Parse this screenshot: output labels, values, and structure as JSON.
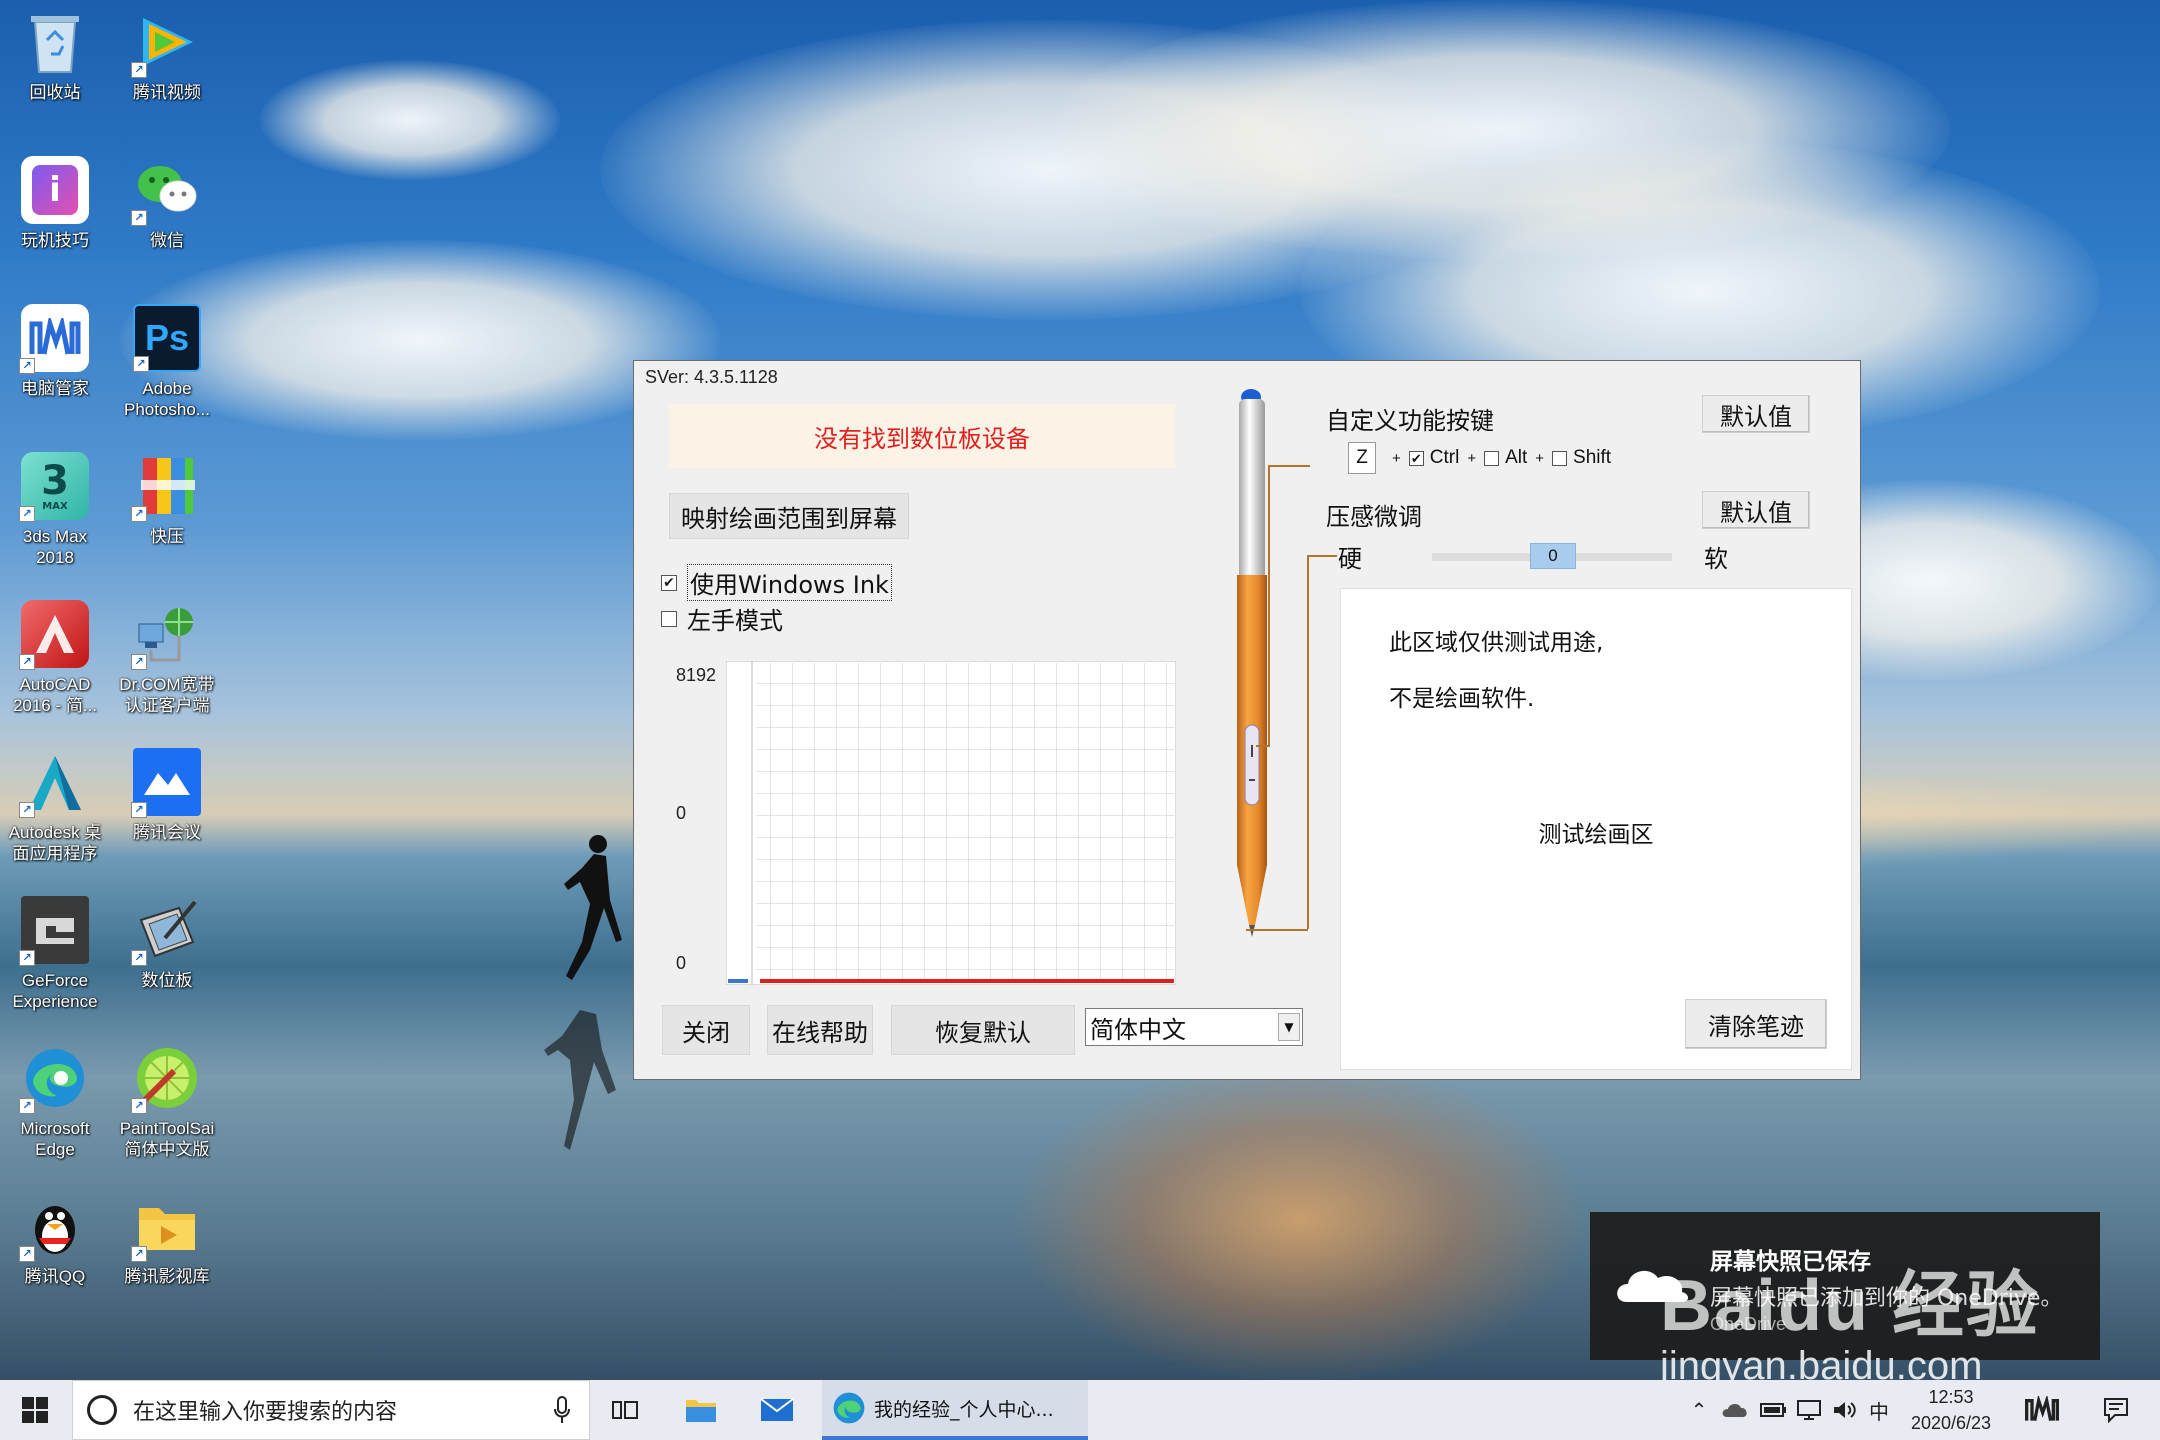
{
  "desktop": {
    "icons": [
      {
        "label": "回收站"
      },
      {
        "label": "腾讯视频"
      },
      {
        "label": "玩机技巧"
      },
      {
        "label": "微信"
      },
      {
        "label": "电脑管家"
      },
      {
        "label": "Adobe\nPhotosho..."
      },
      {
        "label": "3ds Max\n2018"
      },
      {
        "label": "快压"
      },
      {
        "label": "AutoCAD\n2016 - 简..."
      },
      {
        "label": "Dr.COM宽带\n认证客户端"
      },
      {
        "label": "Autodesk 桌\n面应用程序"
      },
      {
        "label": "腾讯会议"
      },
      {
        "label": "GeForce\nExperience"
      },
      {
        "label": "数位板"
      },
      {
        "label": "Microsoft\nEdge"
      },
      {
        "label": "PaintToolSai\n简体中文版"
      },
      {
        "label": "腾讯QQ"
      },
      {
        "label": "腾讯影视库"
      }
    ],
    "icon_glyphs": {
      "photoshop": "Ps",
      "max": "3",
      "max_sub": "MAX",
      "qq": "QQ"
    }
  },
  "app": {
    "version": "SVer: 4.3.5.1128",
    "status": "没有找到数位板设备",
    "map_button": "映射绘画范围到屏幕",
    "use_windows_ink": {
      "label": "使用Windows Ink",
      "checked": true
    },
    "left_hand_mode": {
      "label": "左手模式",
      "checked": false
    },
    "graph": {
      "label_top": "8192",
      "label_mid": "0",
      "label_bottom": "0"
    },
    "buttons": {
      "close": "关闭",
      "help": "在线帮助",
      "reset": "恢复默认",
      "clear": "清除笔迹",
      "default1": "默认值",
      "default2": "默认值"
    },
    "language": "简体中文",
    "custom_keys": {
      "title": "自定义功能按键",
      "key": "Z",
      "plus": "+",
      "ctrl": {
        "label": "Ctrl",
        "checked": true
      },
      "alt": {
        "label": "Alt",
        "checked": false
      },
      "shift": {
        "label": "Shift",
        "checked": false
      }
    },
    "pressure": {
      "title": "压感微调",
      "hard": "硬",
      "soft": "软",
      "value": "0"
    },
    "test_area": {
      "line1": "此区域仅供测试用途,",
      "line2": "不是绘画软件.",
      "center": "测试绘画区"
    }
  },
  "toast": {
    "title": "屏幕快照已保存",
    "body": "屏幕快照已添加到你的 OneDrive。",
    "source": "OneDrive"
  },
  "watermark": {
    "brand": "Baidu 经验",
    "url": "jingyan.baidu.com"
  },
  "taskbar": {
    "search_placeholder": "在这里输入你要搜索的内容",
    "active_app": "我的经验_个人中心...",
    "ime": "中",
    "time": "12:53",
    "date": "2020/6/23"
  },
  "colors": {
    "status_red": "#e32020",
    "pen_orange": "#e8892a",
    "leader": "#b5742c",
    "accent": "#3a78d4"
  }
}
